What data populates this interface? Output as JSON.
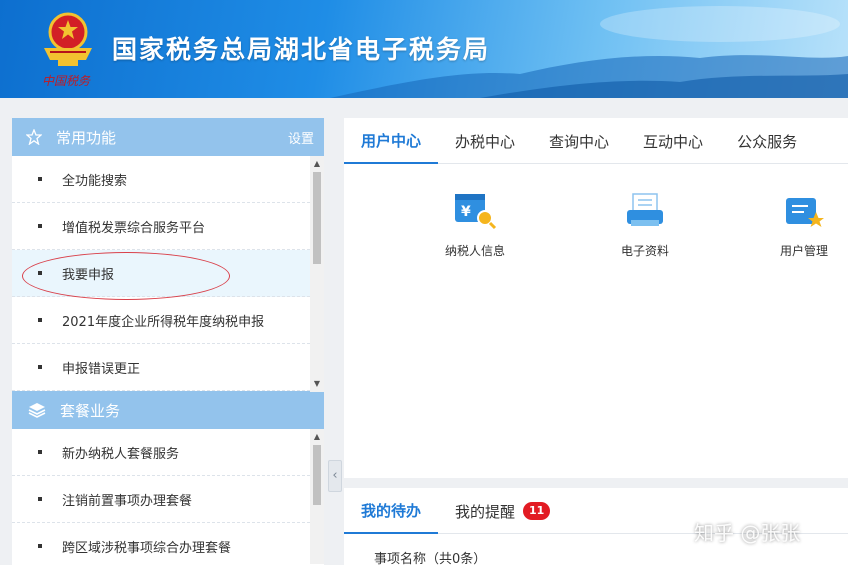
{
  "header": {
    "title": "国家税务总局湖北省电子税务局",
    "seal_text": "中国税务"
  },
  "sidebar": {
    "common": {
      "title": "常用功能",
      "settings_label": "设置",
      "items": [
        {
          "label": "全功能搜索"
        },
        {
          "label": "增值税发票综合服务平台"
        },
        {
          "label": "我要申报"
        },
        {
          "label": "2021年度企业所得税年度纳税申报"
        },
        {
          "label": "申报错误更正"
        }
      ]
    },
    "package": {
      "title": "套餐业务",
      "items": [
        {
          "label": "新办纳税人套餐服务"
        },
        {
          "label": "注销前置事项办理套餐"
        },
        {
          "label": "跨区域涉税事项综合办理套餐"
        }
      ]
    }
  },
  "main": {
    "tabs": [
      {
        "label": "用户中心"
      },
      {
        "label": "办税中心"
      },
      {
        "label": "查询中心"
      },
      {
        "label": "互动中心"
      },
      {
        "label": "公众服务"
      }
    ],
    "tiles": [
      {
        "label": "纳税人信息",
        "icon": "taxpayer-info-icon"
      },
      {
        "label": "电子资料",
        "icon": "electronic-documents-icon"
      },
      {
        "label": "用户管理",
        "icon": "user-management-icon"
      }
    ]
  },
  "todo": {
    "tabs": [
      {
        "label": "我的待办"
      },
      {
        "label": "我的提醒",
        "badge": "11"
      }
    ],
    "column_header": "事项名称（共0条）"
  },
  "watermark": "知乎 @张张",
  "colors": {
    "accent": "#1f7ad6",
    "sidebar_header": "#93c3ec",
    "badge": "#e21b23",
    "annotation": "#d9414b"
  }
}
